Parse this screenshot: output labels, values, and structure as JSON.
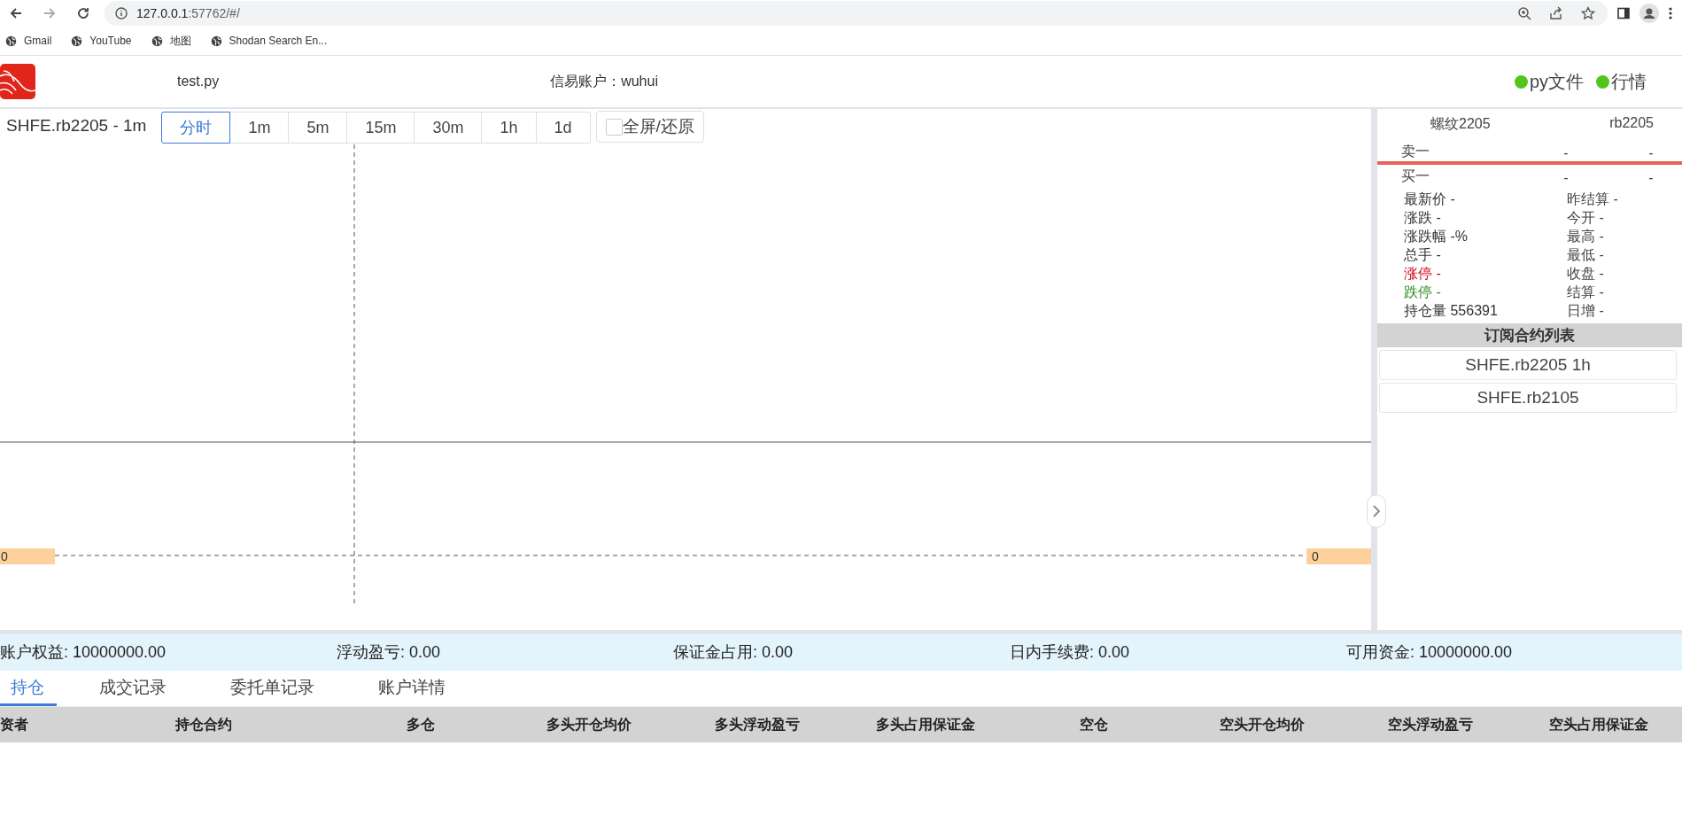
{
  "browser": {
    "nav": [
      {
        "kind": "back",
        "disabled": false
      },
      {
        "kind": "forward",
        "disabled": true
      },
      {
        "kind": "reload",
        "disabled": false
      }
    ],
    "url_host": "127.0.0.1",
    "url_rest": ":57762/#/",
    "bookmarks": [
      "Gmail",
      "YouTube",
      "地图",
      "Shodan Search En..."
    ]
  },
  "header": {
    "file": "test.py",
    "account": "信易账户：wuhui",
    "status": [
      {
        "label": "py文件",
        "color": "#52c41a"
      },
      {
        "label": "行情",
        "color": "#52c41a"
      }
    ]
  },
  "chart": {
    "title": "SHFE.rb2205 - 1m",
    "periods": [
      {
        "label": "分时",
        "selected": true
      },
      {
        "label": "1m",
        "selected": false
      },
      {
        "label": "5m",
        "selected": false
      },
      {
        "label": "15m",
        "selected": false
      },
      {
        "label": "30m",
        "selected": false
      },
      {
        "label": "1h",
        "selected": false
      },
      {
        "label": "1d",
        "selected": false
      }
    ],
    "fullscreen": {
      "label": "全屏/还原",
      "checked": false
    },
    "left_price": "0",
    "right_price": "0"
  },
  "quote": {
    "name": "螺纹2205",
    "code": "rb2205",
    "book": [
      {
        "label": "卖一",
        "price": "-",
        "volume": "-"
      },
      {
        "label": "买一",
        "price": "-",
        "volume": "-"
      }
    ],
    "stats_left": [
      {
        "text": "最新价 -",
        "color": "#333333"
      },
      {
        "text": "涨跌 -",
        "color": "#333333"
      },
      {
        "text": "涨跌幅 -%",
        "color": "#333333"
      },
      {
        "text": "总手 -",
        "color": "#333333"
      },
      {
        "text": "涨停 -",
        "color": "#d0021b"
      },
      {
        "text": "跌停 -",
        "color": "#2e8b22"
      },
      {
        "text": "持仓量 556391",
        "color": "#333333"
      }
    ],
    "stats_right": [
      "昨结算 -",
      "今开 -",
      "最高 -",
      "最低 -",
      "收盘 -",
      "结算 -",
      "日增 -"
    ]
  },
  "subscriptions": {
    "title": "订阅合约列表",
    "items": [
      "SHFE.rb2205 1h",
      "SHFE.rb2105"
    ]
  },
  "account_summary": [
    "账户权益: 10000000.00",
    "浮动盈亏: 0.00",
    "保证金占用: 0.00",
    "日内手续费: 0.00",
    "可用资金: 10000000.00"
  ],
  "bottom_tabs": [
    {
      "label": "持仓",
      "selected": true
    },
    {
      "label": "成交记录",
      "selected": false
    },
    {
      "label": "委托单记录",
      "selected": false
    },
    {
      "label": "账户详情",
      "selected": false
    }
  ],
  "positions_table": {
    "columns": [
      "资者",
      "持仓合约",
      "多仓",
      "多头开仓均价",
      "多头浮动盈亏",
      "多头占用保证金",
      "空仓",
      "空头开仓均价",
      "空头浮动盈亏",
      "空头占用保证金"
    ]
  }
}
